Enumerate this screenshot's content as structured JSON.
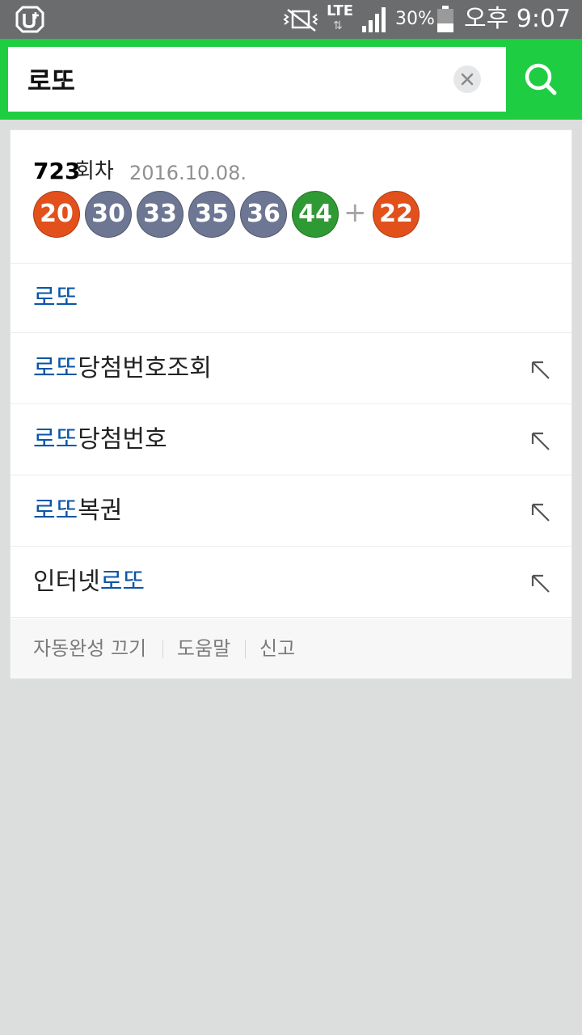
{
  "status_bar": {
    "network": "LTE",
    "network_arrows": "⇅",
    "battery": "30%",
    "time": "오후 9:07",
    "icons": [
      "app-logo-icon",
      "vibrate-icon",
      "signal-icon",
      "battery-icon"
    ]
  },
  "search": {
    "query": "로또",
    "clear_icon": "close-icon",
    "submit_icon": "search-icon",
    "accent_color": "#1fcd43"
  },
  "lotto": {
    "round_number": "723",
    "round_suffix": "회차",
    "date": "2016.10.08.",
    "balls": [
      {
        "number": "20",
        "color": "#e2501c"
      },
      {
        "number": "30",
        "color": "#6d7692"
      },
      {
        "number": "33",
        "color": "#6d7692"
      },
      {
        "number": "35",
        "color": "#6d7692"
      },
      {
        "number": "36",
        "color": "#6d7692"
      },
      {
        "number": "44",
        "color": "#2f9a34"
      }
    ],
    "plus": "+",
    "bonus": {
      "number": "22",
      "color": "#e2501c"
    }
  },
  "suggestions": [
    {
      "prefix": "",
      "highlight": "로또",
      "suffix": "",
      "has_arrow": false
    },
    {
      "prefix": "",
      "highlight": "로또",
      "suffix": "당첨번호조회",
      "has_arrow": true
    },
    {
      "prefix": "",
      "highlight": "로또",
      "suffix": "당첨번호",
      "has_arrow": true
    },
    {
      "prefix": "",
      "highlight": "로또",
      "suffix": "복권",
      "has_arrow": true
    },
    {
      "prefix": "인터넷",
      "highlight": "로또",
      "suffix": "",
      "has_arrow": true
    }
  ],
  "highlight_color": "#0a56a8",
  "footer": {
    "autocomplete_off": "자동완성 끄기",
    "help": "도움말",
    "report": "신고"
  }
}
